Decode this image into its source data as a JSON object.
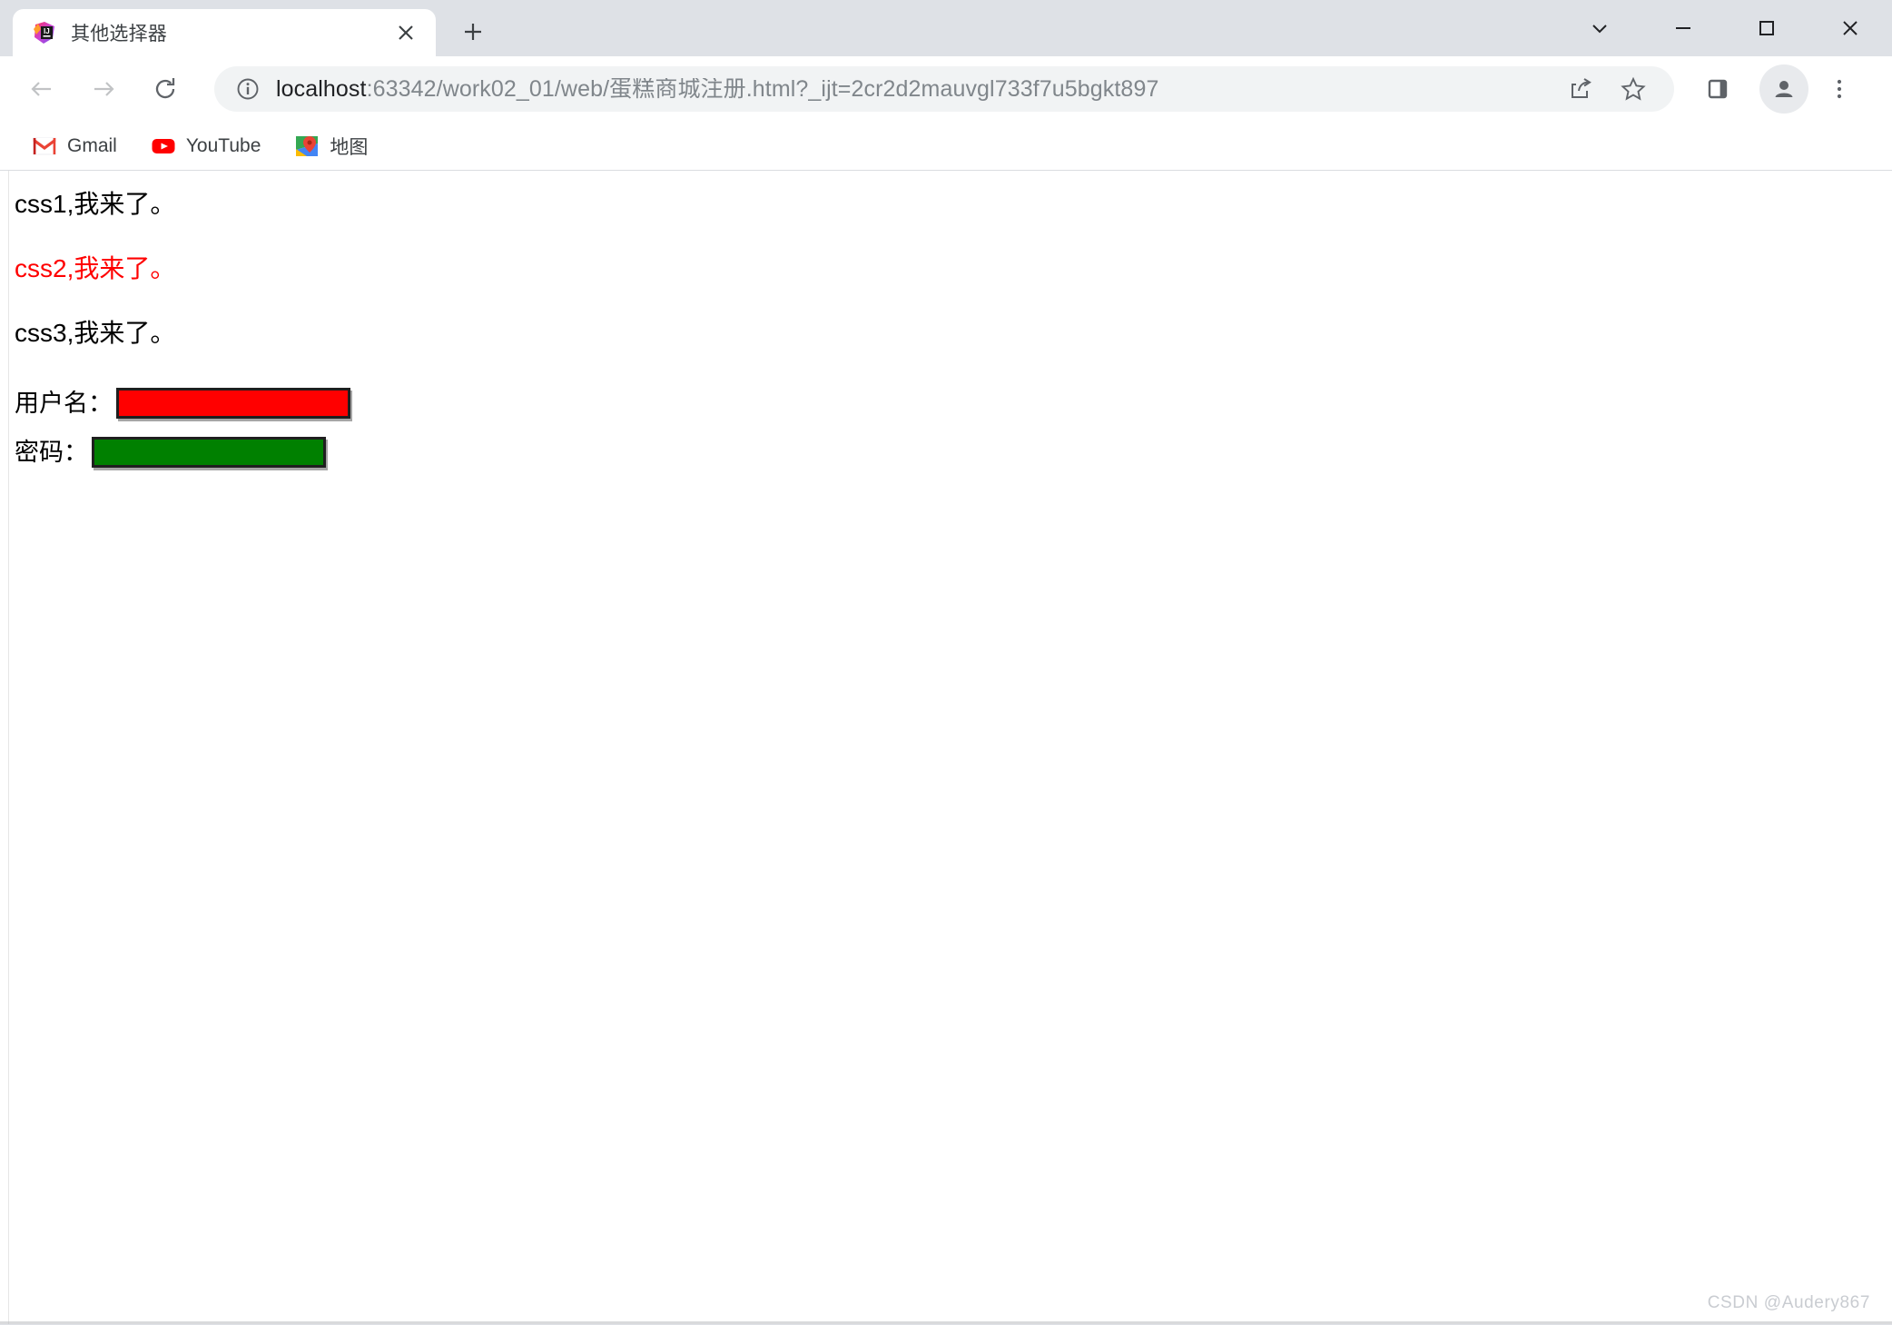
{
  "browser": {
    "tab": {
      "title": "其他选择器",
      "favicon_name": "intellij-idea-icon",
      "close_label": "×"
    },
    "new_tab_label": "+",
    "window_controls": [
      {
        "name": "tab-search-button",
        "label": "⌄"
      },
      {
        "name": "minimize-button",
        "label": "—"
      },
      {
        "name": "maximize-button",
        "label": "□"
      },
      {
        "name": "close-window-button",
        "label": "✕"
      }
    ],
    "navigation": {
      "back_label": "←",
      "forward_label": "→",
      "reload_label": "⟳"
    },
    "omnibox": {
      "site_info_label": "ⓘ",
      "url_host": "localhost",
      "url_rest": ":63342/work02_01/web/蛋糕商城注册.html?_ijt=2cr2d2mauvgl733f7u5bgkt897",
      "full_url": "localhost:63342/work02_01/web/蛋糕商城注册.html?_ijt=2cr2d2mauvgl733f7u5bgkt897",
      "share_label": "share-icon",
      "bookmark_label": "★"
    },
    "toolbar_right": {
      "side_panel_label": "side-panel-icon",
      "profile_label": "profile-avatar",
      "menu_label": "⋮"
    },
    "bookmarks": [
      {
        "name": "bookmark-gmail",
        "label": "Gmail",
        "icon": "gmail-icon"
      },
      {
        "name": "bookmark-youtube",
        "label": "YouTube",
        "icon": "youtube-icon"
      },
      {
        "name": "bookmark-maps",
        "label": "地图",
        "icon": "google-maps-icon"
      }
    ]
  },
  "page": {
    "paragraphs": [
      {
        "text": "css1,我来了。",
        "color": "#000000"
      },
      {
        "text": "css2,我来了。",
        "color": "#ff0000"
      },
      {
        "text": "css3,我来了。",
        "color": "#000000"
      }
    ],
    "form": {
      "username": {
        "label": "用户名：",
        "value": "",
        "placeholder": "",
        "background": "#ff0000"
      },
      "password": {
        "label": "密码：",
        "value": "",
        "placeholder": "",
        "background": "#008000"
      }
    },
    "watermark": "CSDN @Audery867"
  }
}
